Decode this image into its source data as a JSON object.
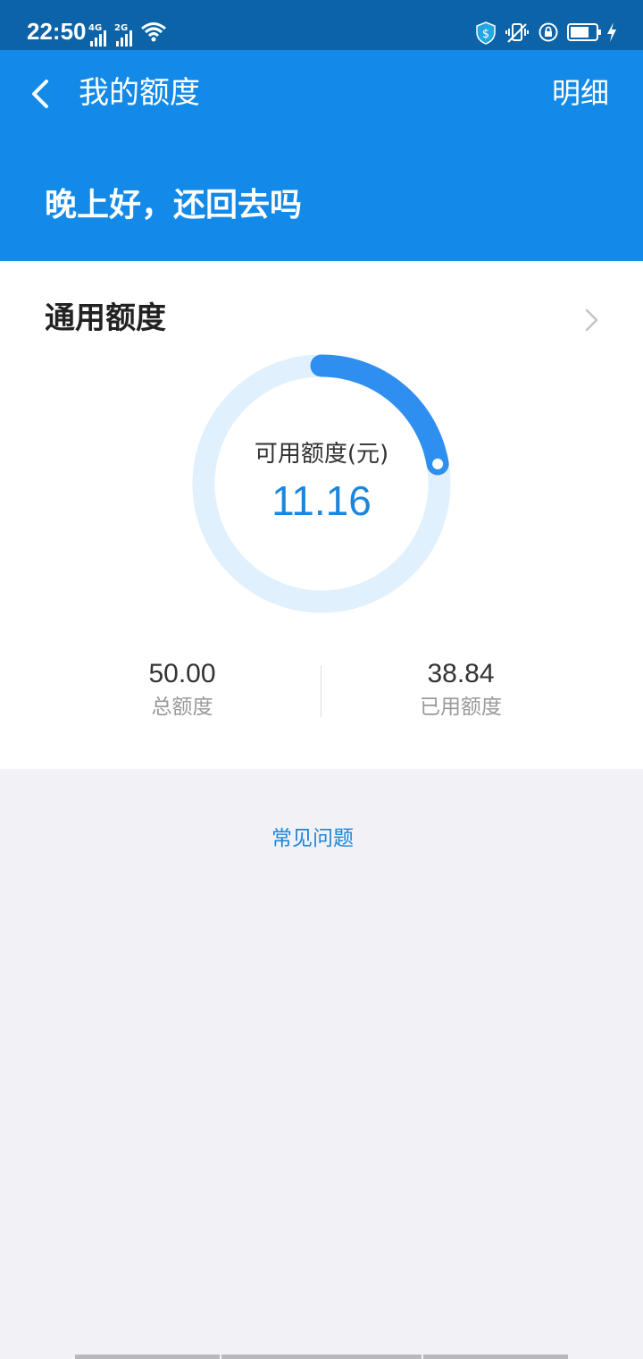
{
  "status_bar": {
    "time": "22:50",
    "signal1_label": "4G",
    "signal2_label": "2G",
    "icons": [
      "signal-icon",
      "wifi-icon",
      "shield-dollar-icon",
      "vibrate-icon",
      "lock-rotation-icon",
      "battery-icon",
      "charging-icon"
    ]
  },
  "nav": {
    "title": "我的额度",
    "detail_label": "明细",
    "back_icon": "chevron-left-icon"
  },
  "greeting": "晚上好，还回去吗",
  "quota_card": {
    "title": "通用额度",
    "available_label": "可用额度(元)",
    "available_value": "11.16",
    "available_fraction": 0.2232,
    "total_value": "50.00",
    "total_label": "总额度",
    "used_value": "38.84",
    "used_label": "已用额度"
  },
  "faq_label": "常见问题",
  "colors": {
    "status_bar": "#0c63a7",
    "header": "#1389e8",
    "accent": "#1b86dc",
    "ring_track": "#e0f0fd",
    "ring_progress": "#2f8ff0",
    "page_bg": "#f2f2f6"
  }
}
